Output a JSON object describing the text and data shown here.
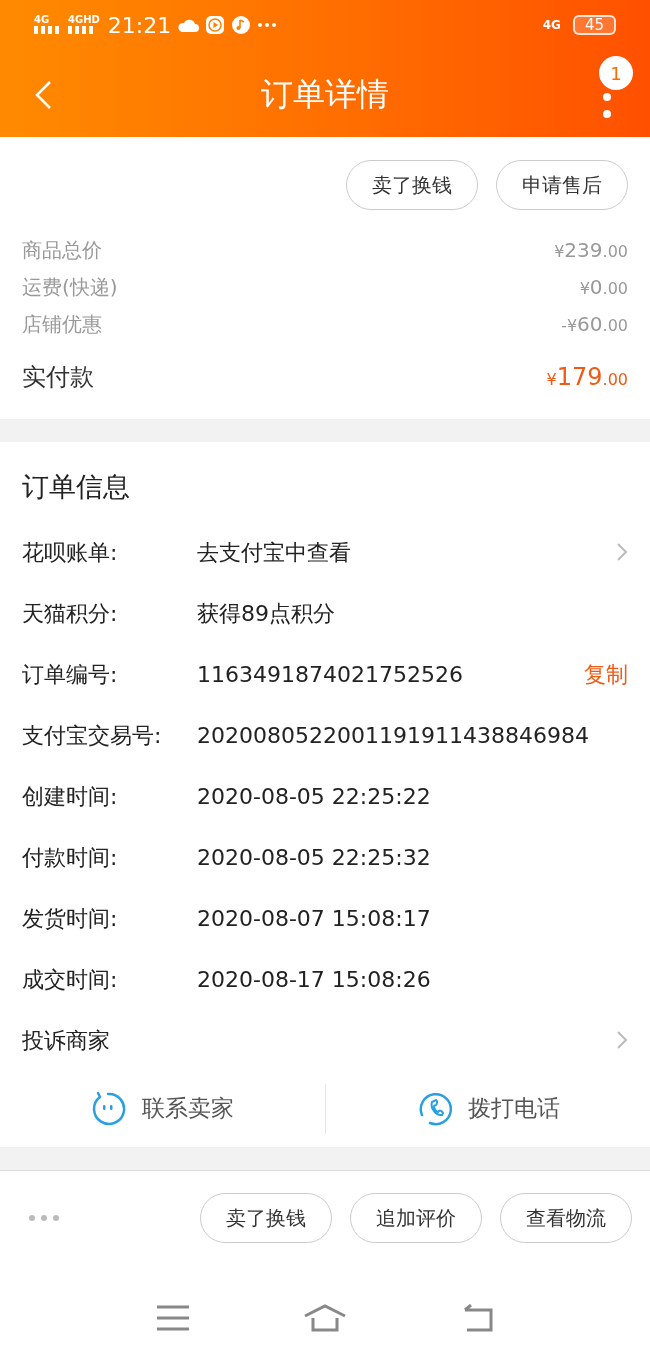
{
  "status_bar": {
    "signals": [
      "4G",
      "4GHD"
    ],
    "time": "21:21",
    "network": "4G",
    "battery": "45"
  },
  "header": {
    "title": "订单详情",
    "badge": "1"
  },
  "top_actions": [
    "卖了换钱",
    "申请售后"
  ],
  "prices": [
    {
      "label": "商品总价",
      "prefix": "¥",
      "amount": "239",
      "cents": ".00"
    },
    {
      "label": "运费(快递)",
      "prefix": "¥",
      "amount": "0",
      "cents": ".00"
    },
    {
      "label": "店铺优惠",
      "prefix": "-¥",
      "amount": "60",
      "cents": ".00"
    }
  ],
  "total": {
    "label": "实付款",
    "prefix": "¥",
    "amount": "179",
    "cents": ".00"
  },
  "order_info": {
    "title": "订单信息",
    "rows": [
      {
        "kind": "link",
        "label": "花呗账单:",
        "value": "去支付宝中查看"
      },
      {
        "kind": "plain",
        "label": "天猫积分:",
        "value": "获得89点积分"
      },
      {
        "kind": "copy",
        "label": "订单编号:",
        "value": "1163491874021752526",
        "action": "复制"
      },
      {
        "kind": "plain",
        "label": "支付宝交易号:",
        "value": "2020080522001191911438846984"
      },
      {
        "kind": "plain",
        "label": "创建时间:",
        "value": "2020-08-05 22:25:22"
      },
      {
        "kind": "plain",
        "label": "付款时间:",
        "value": "2020-08-05 22:25:32"
      },
      {
        "kind": "plain",
        "label": "发货时间:",
        "value": "2020-08-07 15:08:17"
      },
      {
        "kind": "plain",
        "label": "成交时间:",
        "value": "2020-08-17 15:08:26"
      },
      {
        "kind": "link",
        "label": "投诉商家"
      }
    ]
  },
  "contact": [
    {
      "kind": "chat",
      "label": "联系卖家"
    },
    {
      "kind": "phone",
      "label": "拨打电话"
    }
  ],
  "bottom_actions": [
    "卖了换钱",
    "追加评价",
    "查看物流"
  ]
}
